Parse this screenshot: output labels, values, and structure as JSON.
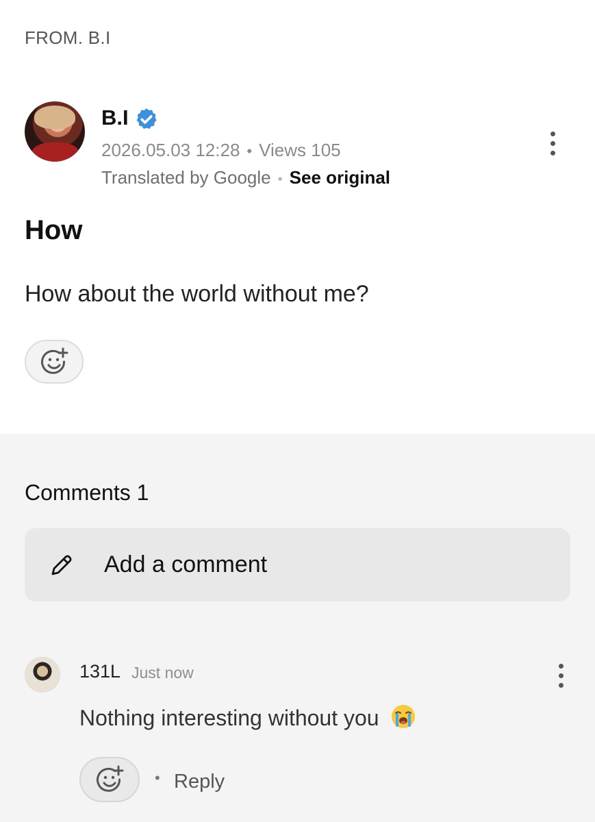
{
  "header": {
    "from_label": "FROM. B.I"
  },
  "post": {
    "author": "B.I",
    "date": "2026.05.03 12:28",
    "views": "Views 105",
    "translated_by": "Translated by Google",
    "see_original": "See original",
    "title": "How",
    "body": "How about the world without me?"
  },
  "comments": {
    "heading": "Comments 1",
    "add_placeholder": "Add a comment",
    "items": [
      {
        "author": "131L",
        "time": "Just now",
        "text": "Nothing interesting without you",
        "reply_label": "Reply"
      }
    ]
  },
  "icons": {
    "verified": "verified-badge-icon",
    "more": "more-vertical-icon",
    "add_reaction": "add-reaction-icon",
    "pencil": "pencil-icon",
    "emoji": "loudly-crying-face-emoji"
  },
  "colors": {
    "verified_blue": "#3d8fe0",
    "comments_bg": "#f4f4f4",
    "input_bg": "#e8e8e8"
  }
}
